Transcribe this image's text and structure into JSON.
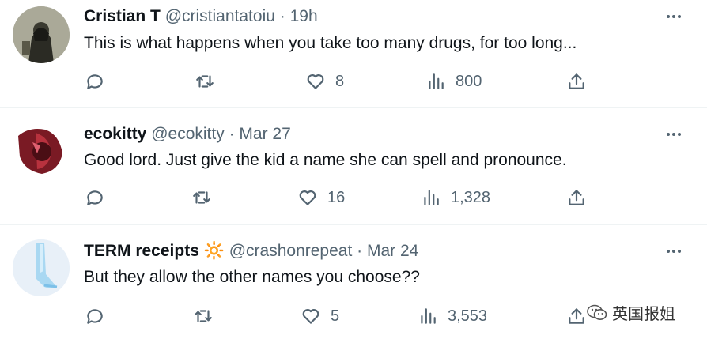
{
  "tweets": [
    {
      "name": "Cristian T",
      "handle": "@cristiantatoiu",
      "separator": "·",
      "time": "19h",
      "text": "This is what happens when you take too many drugs, for too long...",
      "likes": "8",
      "views": "800"
    },
    {
      "name": "ecokitty",
      "handle": "@ecokitty",
      "separator": "·",
      "time": "Mar 27",
      "text": "Good lord. Just give the kid a name she can spell and pronounce.",
      "likes": "16",
      "views": "1,328"
    },
    {
      "name": "TERM receipts",
      "badge_emoji": "🔆",
      "handle": "@crashonrepeat",
      "separator": "·",
      "time": "Mar 24",
      "text": "But they allow the other names you choose??",
      "likes": "5",
      "views": "3,553"
    }
  ],
  "watermark": {
    "text": "英国报姐"
  },
  "icons": [
    "reply-icon",
    "retweet-icon",
    "like-icon",
    "views-icon",
    "share-icon",
    "more-icon"
  ],
  "colors": {
    "text": "#0f1419",
    "secondary": "#536471",
    "divider": "#eff3f4"
  }
}
